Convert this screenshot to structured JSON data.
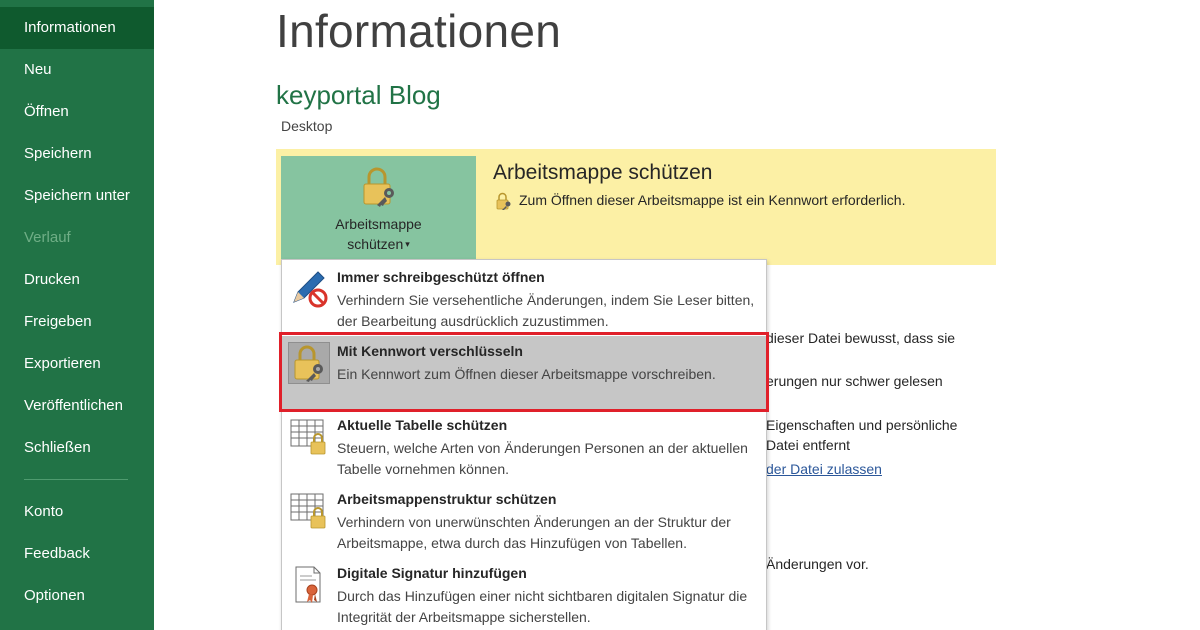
{
  "sidebar": {
    "items": [
      {
        "label": "Informationen"
      },
      {
        "label": "Neu"
      },
      {
        "label": "Öffnen"
      },
      {
        "label": "Speichern"
      },
      {
        "label": "Speichern unter"
      },
      {
        "label": "Verlauf"
      },
      {
        "label": "Drucken"
      },
      {
        "label": "Freigeben"
      },
      {
        "label": "Exportieren"
      },
      {
        "label": "Veröffentlichen"
      },
      {
        "label": "Schließen"
      },
      {
        "label": "Konto"
      },
      {
        "label": "Feedback"
      },
      {
        "label": "Optionen"
      }
    ],
    "active": "Informationen",
    "disabled": "Verlauf"
  },
  "main": {
    "title": "Informationen",
    "file_name": "keyportal Blog",
    "file_location": "Desktop"
  },
  "protect": {
    "button_label_line1": "Arbeitsmappe",
    "button_label_line2": "schützen",
    "heading": "Arbeitsmappe schützen",
    "description": "Zum Öffnen dieser Arbeitsmappe ist ein Kennwort erforderlich."
  },
  "background_text": {
    "line1": "dieser Datei bewusst, dass sie",
    "line2": "erungen nur schwer gelesen",
    "line3": "Eigenschaften und persönliche",
    "line4": "Datei entfernt",
    "link": "der Datei zulassen",
    "line5": "Änderungen vor."
  },
  "menu": {
    "items": [
      {
        "title": "Immer schreibgeschützt öffnen",
        "desc": "Verhindern Sie versehentliche Änderungen, indem Sie Leser bitten, der Bearbeitung ausdrücklich zuzustimmen."
      },
      {
        "title": "Mit Kennwort verschlüsseln",
        "desc": "Ein Kennwort zum Öffnen dieser Arbeitsmappe vorschreiben."
      },
      {
        "title": "Aktuelle Tabelle schützen",
        "desc": "Steuern, welche Arten von Änderungen Personen an der aktuellen Tabelle vornehmen können."
      },
      {
        "title": "Arbeitsmappenstruktur schützen",
        "desc": "Verhindern von unerwünschten Änderungen an der Struktur der Arbeitsmappe, etwa durch das Hinzufügen von Tabellen."
      },
      {
        "title": "Digitale Signatur hinzufügen",
        "desc": "Durch das Hinzufügen einer nicht sichtbaren digitalen Signatur die Integrität der Arbeitsmappe sicherstellen."
      }
    ],
    "highlighted_index": 1
  },
  "colors": {
    "sidebar_bg": "#217346",
    "sidebar_active": "#0f5a2e",
    "accent_green": "#217346",
    "panel_yellow": "#fcf0a5",
    "button_green": "#86c4a0",
    "highlight_border": "#e0202a"
  }
}
